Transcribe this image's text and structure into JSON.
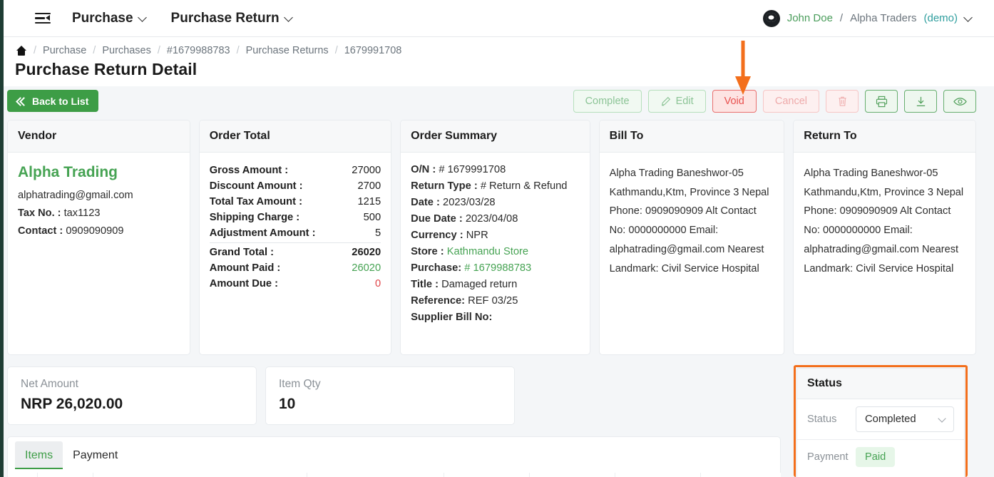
{
  "navbar": {
    "menu_icon": "menu-fold-icon",
    "items": [
      {
        "label": "Purchase"
      },
      {
        "label": "Purchase Return"
      }
    ],
    "user": {
      "avatar_icon": "github-logo-icon",
      "name": "John Doe",
      "separator": "/",
      "org": "Alpha Traders",
      "mode": "(demo)"
    }
  },
  "breadcrumb": {
    "home_icon": "home-icon",
    "items": [
      "Purchase",
      "Purchases",
      "#1679988783",
      "Purchase Returns",
      "1679991708"
    ],
    "separator": "/"
  },
  "page_title": "Purchase Return Detail",
  "actions": {
    "back": "Back to List",
    "complete": "Complete",
    "edit": "Edit",
    "void": "Void",
    "cancel": "Cancel",
    "delete_icon": "trash-icon",
    "print_icon": "print-icon",
    "download_icon": "download-icon",
    "preview_icon": "eye-icon"
  },
  "annotation": {
    "arrow_icon": "orange-arrow-down-icon",
    "arrow_target": "Void",
    "highlight_target": "Status panel",
    "color": "#f36f1c"
  },
  "vendor": {
    "title": "Vendor",
    "name": "Alpha Trading",
    "email": "alphatrading@gmail.com",
    "tax_label": "Tax No. :",
    "tax_value": "tax1123",
    "contact_label": "Contact :",
    "contact_value": "0909090909"
  },
  "order_total": {
    "title": "Order Total",
    "rows": [
      {
        "label": "Gross Amount :",
        "value": "27000"
      },
      {
        "label": "Discount Amount :",
        "value": "2700"
      },
      {
        "label": "Total Tax Amount :",
        "value": "1215"
      },
      {
        "label": "Shipping Charge :",
        "value": "500"
      },
      {
        "label": "Adjustment Amount :",
        "value": "5"
      },
      {
        "label": "Grand Total :",
        "value": "26020"
      },
      {
        "label": "Amount Paid :",
        "value": "26020"
      },
      {
        "label": "Amount Due :",
        "value": "0"
      }
    ]
  },
  "order_summary": {
    "title": "Order Summary",
    "on_label": "O/N :",
    "on_value": "# 1679991708",
    "return_type_label": "Return Type :",
    "return_type_value": "# Return & Refund",
    "date_label": "Date :",
    "date_value": "2023/03/28",
    "due_date_label": "Due Date :",
    "due_date_value": "2023/04/08",
    "currency_label": "Currency :",
    "currency_value": "NPR",
    "store_label": "Store :",
    "store_value": "Kathmandu Store",
    "purchase_label": "Purchase:",
    "purchase_value": "# 1679988783",
    "title_label": "Title :",
    "title_value": "Damaged return",
    "reference_label": "Reference:",
    "reference_value": "REF 03/25",
    "supplier_bill_label": "Supplier Bill No:",
    "supplier_bill_value": ""
  },
  "bill_to": {
    "title": "Bill To",
    "address": "Alpha Trading Baneshwor-05 Kathmandu,Ktm, Province 3 Nepal Phone: 0909090909 Alt Contact No: 0000000000 Email: alphatrading@gmail.com Nearest Landmark: Civil Service Hospital"
  },
  "return_to": {
    "title": "Return To",
    "address": "Alpha Trading Baneshwor-05 Kathmandu,Ktm, Province 3 Nepal Phone: 0909090909 Alt Contact No: 0000000000 Email: alphatrading@gmail.com Nearest Landmark: Civil Service Hospital"
  },
  "stats": {
    "net_label": "Net Amount",
    "net_value": "NRP 26,020.00",
    "qty_label": "Item Qty",
    "qty_value": "10"
  },
  "tabs": [
    {
      "label": "Items",
      "active": true
    },
    {
      "label": "Payment",
      "active": false
    }
  ],
  "status_panel": {
    "title": "Status",
    "status_label": "Status",
    "status_value": "Completed",
    "status_chevron_icon": "chevron-down-icon",
    "payment_label": "Payment",
    "payment_value": "Paid"
  },
  "colors": {
    "brand_green": "#3d9d46",
    "link_green": "#46a353",
    "danger_red": "#e8504e",
    "annotation_orange": "#f36f1c",
    "page_bg": "#f4f6f8"
  }
}
